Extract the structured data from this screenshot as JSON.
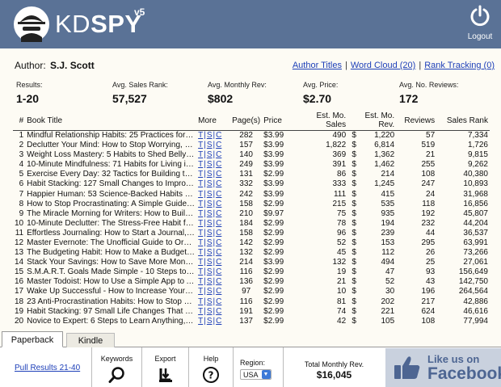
{
  "header": {
    "logo_prefix": "KD",
    "logo_suffix": "SPY",
    "version": "v5",
    "logout_label": "Logout"
  },
  "author": {
    "label": "Author:",
    "name": "S.J. Scott"
  },
  "top_links": {
    "author_titles": "Author Titles",
    "word_cloud": "Word Cloud (20)",
    "rank_tracking": "Rank Tracking (0)"
  },
  "stats": {
    "results_label": "Results:",
    "results_value": "1-20",
    "sales_rank_label": "Avg. Sales Rank:",
    "sales_rank_value": "57,527",
    "monthly_rev_label": "Avg. Monthly Rev:",
    "monthly_rev_value": "$802",
    "price_label": "Avg. Price:",
    "price_value": "$2.70",
    "reviews_label": "Avg. No. Reviews:",
    "reviews_value": "172"
  },
  "table": {
    "headers": {
      "num": "#",
      "title": "Book Title",
      "more": "More",
      "pages": "Page(s)",
      "price": "Price",
      "sales": "Est. Mo. Sales",
      "rev": "Est. Mo. Rev.",
      "reviews": "Reviews",
      "rank": "Sales Rank"
    },
    "more_links": [
      "T",
      "S",
      "C"
    ],
    "rows": [
      {
        "num": "1",
        "title": "Mindful Relationship Habits: 25 Practices for Couples to...",
        "pages": "282",
        "price": "$3.99",
        "sales": "490",
        "dollar": "$",
        "rev": "1,220",
        "reviews": "57",
        "rank": "7,334"
      },
      {
        "num": "2",
        "title": "Declutter Your Mind: How to Stop Worrying, Relieve Anxiety...",
        "pages": "157",
        "price": "$3.99",
        "sales": "1,822",
        "dollar": "$",
        "rev": "6,814",
        "reviews": "519",
        "rank": "1,726"
      },
      {
        "num": "3",
        "title": "Weight Loss Mastery: 5 Habits to Shed Belly Fat and...",
        "pages": "140",
        "price": "$3.99",
        "sales": "369",
        "dollar": "$",
        "rev": "1,362",
        "reviews": "21",
        "rank": "9,815"
      },
      {
        "num": "4",
        "title": "10-Minute Mindfulness: 71 Habits for Living in the Present...",
        "pages": "249",
        "price": "$3.99",
        "sales": "391",
        "dollar": "$",
        "rev": "1,462",
        "reviews": "255",
        "rank": "9,262"
      },
      {
        "num": "5",
        "title": "Exercise Every Day: 32 Tactics for Building the Exercise...",
        "pages": "131",
        "price": "$2.99",
        "sales": "86",
        "dollar": "$",
        "rev": "214",
        "reviews": "108",
        "rank": "40,380"
      },
      {
        "num": "6",
        "title": "Habit Stacking: 127 Small Changes to Improve Your Health...",
        "pages": "332",
        "price": "$3.99",
        "sales": "333",
        "dollar": "$",
        "rev": "1,245",
        "reviews": "247",
        "rank": "10,893"
      },
      {
        "num": "7",
        "title": "Happier Human: 53 Science-Backed Habits to Increase...",
        "pages": "242",
        "price": "$3.99",
        "sales": "111",
        "dollar": "$",
        "rev": "415",
        "reviews": "24",
        "rank": "31,968"
      },
      {
        "num": "8",
        "title": "How to Stop Procrastinating: A Simple Guide to Mastering...",
        "pages": "158",
        "price": "$2.99",
        "sales": "215",
        "dollar": "$",
        "rev": "535",
        "reviews": "118",
        "rank": "16,856"
      },
      {
        "num": "9",
        "title": "The Miracle Morning for Writers: How to Build a Writing...",
        "pages": "210",
        "price": "$9.97",
        "sales": "75",
        "dollar": "$",
        "rev": "935",
        "reviews": "192",
        "rank": "45,807"
      },
      {
        "num": "10",
        "title": "10-Minute Declutter: The Stress-Free Habit for Simplifying...",
        "pages": "184",
        "price": "$2.99",
        "sales": "78",
        "dollar": "$",
        "rev": "194",
        "reviews": "232",
        "rank": "44,204"
      },
      {
        "num": "11",
        "title": "Effortless Journaling: How to Start a Journal, Make It a...",
        "pages": "158",
        "price": "$2.99",
        "sales": "96",
        "dollar": "$",
        "rev": "239",
        "reviews": "44",
        "rank": "36,537"
      },
      {
        "num": "12",
        "title": "Master Evernote: The Unofficial Guide to Organizing Your...",
        "pages": "142",
        "price": "$2.99",
        "sales": "52",
        "dollar": "$",
        "rev": "153",
        "reviews": "295",
        "rank": "63,991"
      },
      {
        "num": "13",
        "title": "The Budgeting Habit: How to Make a Budget and Stick to It...",
        "pages": "132",
        "price": "$2.99",
        "sales": "45",
        "dollar": "$",
        "rev": "112",
        "reviews": "26",
        "rank": "73,266"
      },
      {
        "num": "14",
        "title": "Stack Your Savings: How to Save More Money Each Month...",
        "pages": "214",
        "price": "$3.99",
        "sales": "132",
        "dollar": "$",
        "rev": "494",
        "reviews": "25",
        "rank": "27,061"
      },
      {
        "num": "15",
        "title": "S.M.A.R.T. Goals Made Simple - 10 Steps to Master Your...",
        "pages": "116",
        "price": "$2.99",
        "sales": "19",
        "dollar": "$",
        "rev": "47",
        "reviews": "93",
        "rank": "156,649"
      },
      {
        "num": "16",
        "title": "Master Todoist: How to Use a Simple App to Accomplish...",
        "pages": "136",
        "price": "$2.99",
        "sales": "21",
        "dollar": "$",
        "rev": "52",
        "reviews": "43",
        "rank": "142,750"
      },
      {
        "num": "17",
        "title": "Wake Up Successful - How to Increase Your Energy and...",
        "pages": "97",
        "price": "$2.99",
        "sales": "10",
        "dollar": "$",
        "rev": "30",
        "reviews": "196",
        "rank": "264,564"
      },
      {
        "num": "18",
        "title": "23 Anti-Procrastination Habits: How to Stop Being Lazy...",
        "pages": "116",
        "price": "$2.99",
        "sales": "81",
        "dollar": "$",
        "rev": "202",
        "reviews": "217",
        "rank": "42,886"
      },
      {
        "num": "19",
        "title": "Habit Stacking: 97 Small Life Changes That Take Five...",
        "pages": "191",
        "price": "$2.99",
        "sales": "74",
        "dollar": "$",
        "rev": "221",
        "reviews": "624",
        "rank": "46,616"
      },
      {
        "num": "20",
        "title": "Novice to Expert: 6 Steps to Learn Anything, Increase Your...",
        "pages": "137",
        "price": "$2.99",
        "sales": "42",
        "dollar": "$",
        "rev": "105",
        "reviews": "108",
        "rank": "77,994"
      }
    ]
  },
  "tabs": {
    "paperback": "Paperback",
    "kindle": "Kindle"
  },
  "footer": {
    "pull_results": "Pull Results 21-40",
    "keywords": "Keywords",
    "export": "Export",
    "help": "Help",
    "region_label": "Region:",
    "region_value": "USA",
    "total_label": "Total Monthly Rev.",
    "total_value": "$16,045",
    "fb_like": "Like us on",
    "fb_name": "Facebook"
  },
  "colors": {
    "header_bg": "#5a7296",
    "link": "#1d3fb8",
    "panel_bg": "#fdfbf4",
    "facebook_bg": "#c9d1de",
    "facebook_text": "#4d6592"
  }
}
